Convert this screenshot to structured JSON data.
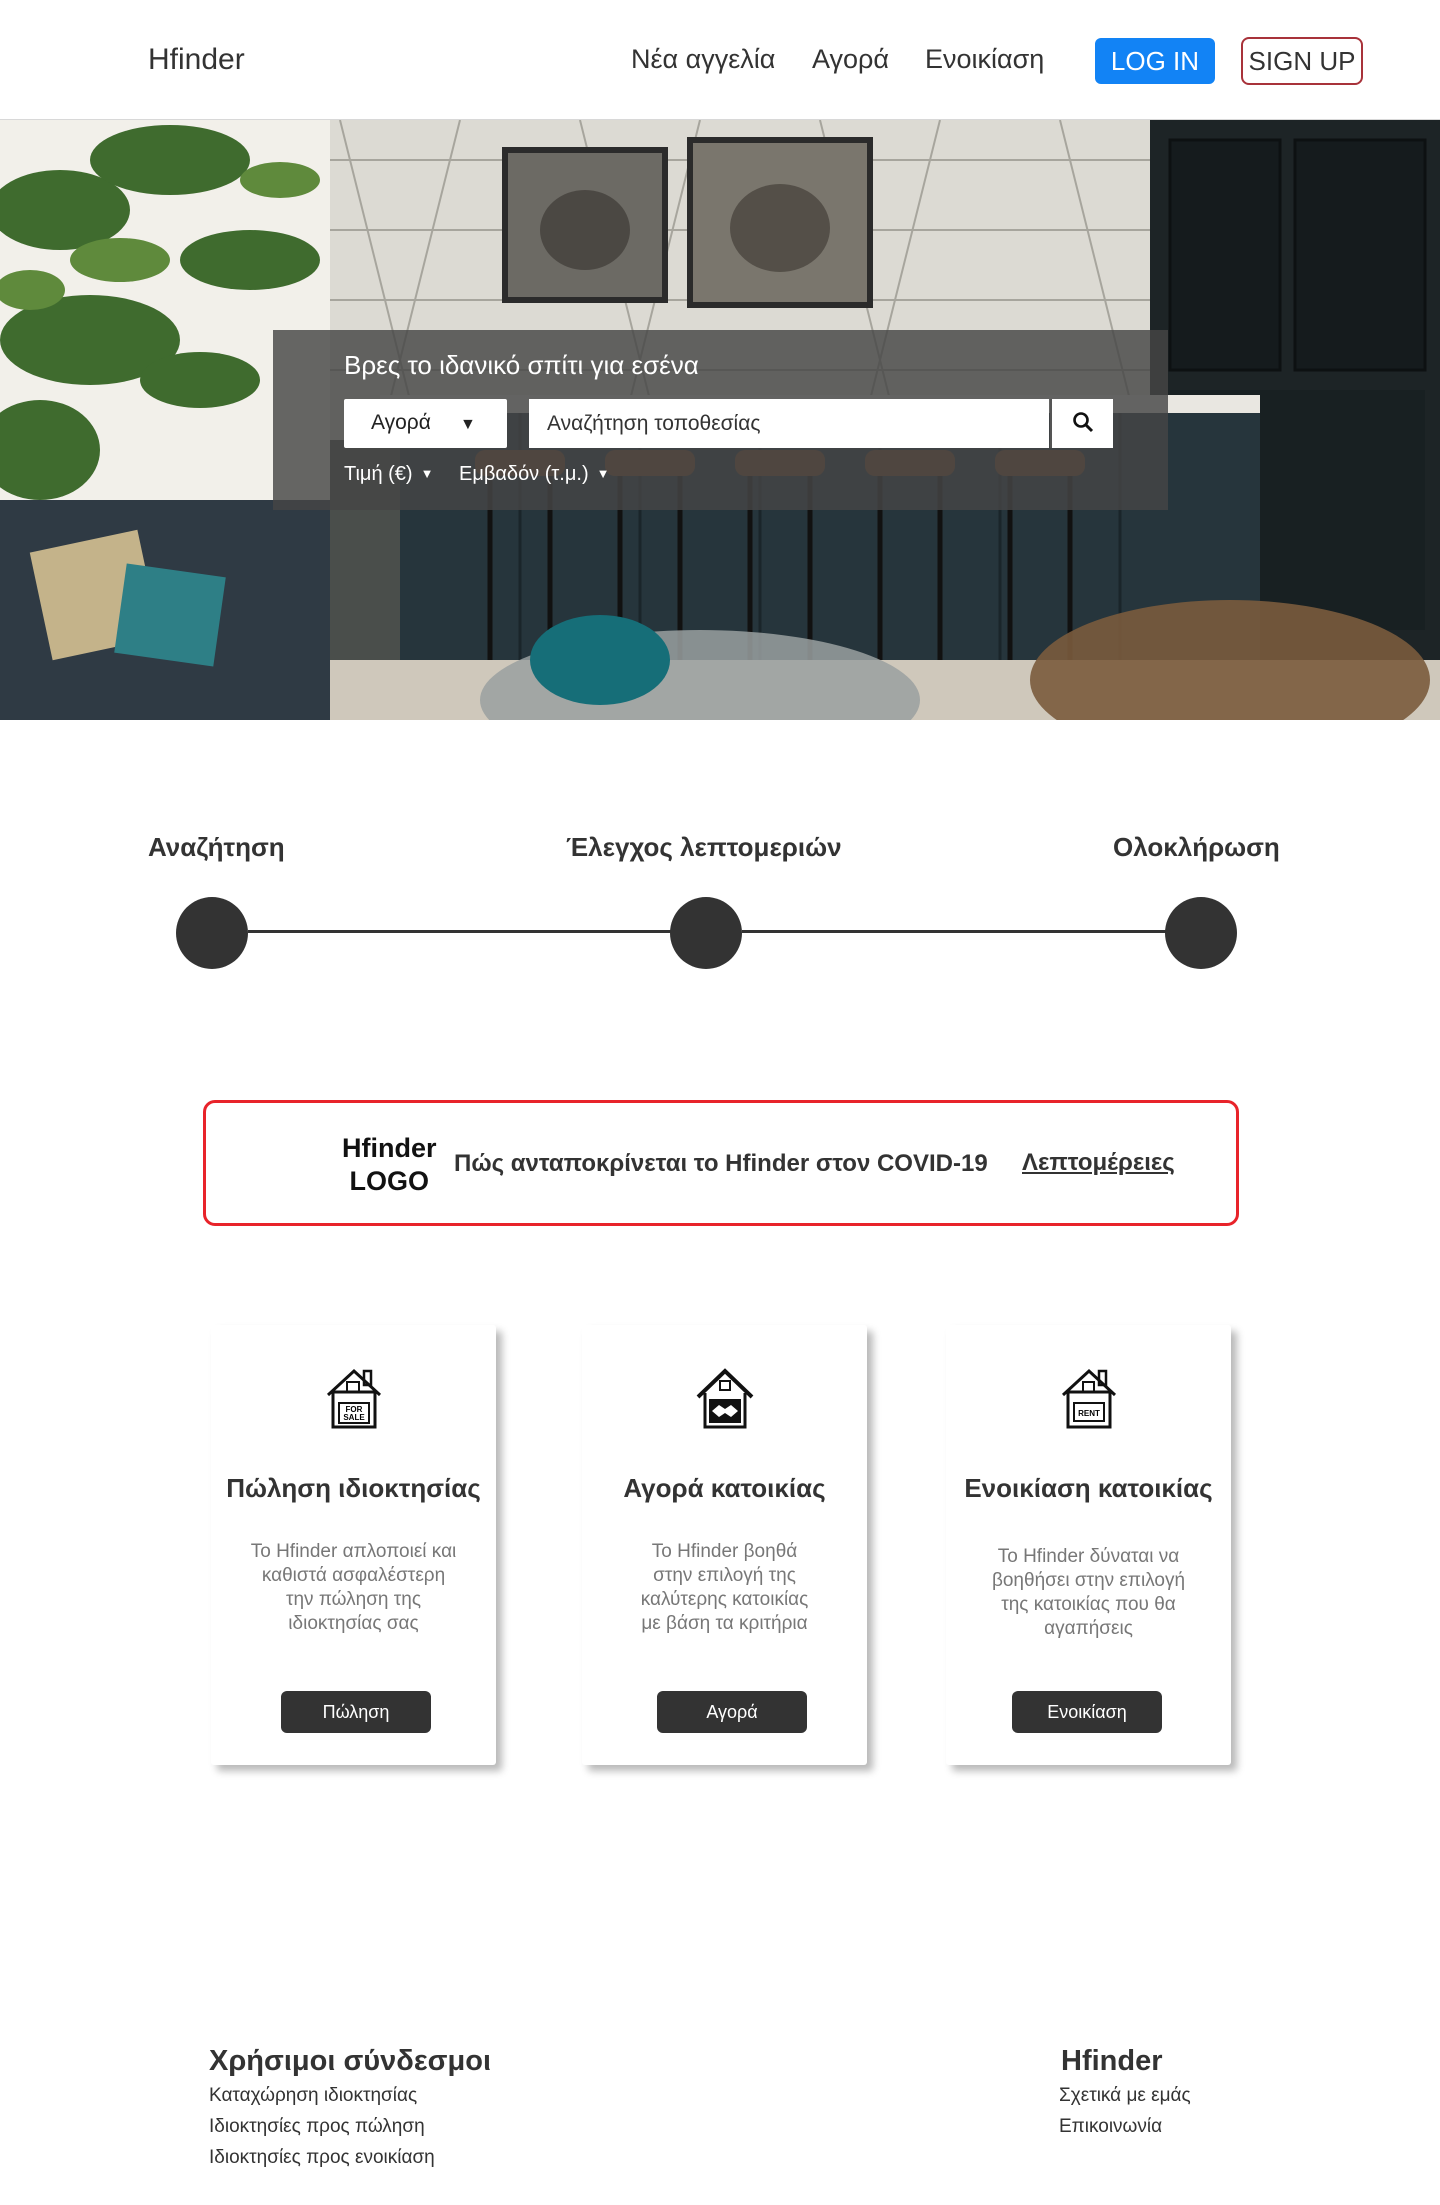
{
  "nav": {
    "brand": "Hfinder",
    "links": [
      "Νέα αγγελία",
      "Αγορά",
      "Ενοικίαση"
    ],
    "login": "LOG IN",
    "signup": "SIGN UP"
  },
  "hero": {
    "title": "Βρες το ιδανικό σπίτι για εσένα",
    "type_selected": "Αγορά",
    "search_placeholder": "Αναζήτηση τοποθεσίας",
    "filters": [
      "Τιμή (€)",
      "Εμβαδόν (τ.μ.)"
    ]
  },
  "steps": [
    "Αναζήτηση",
    "Έλεγχος λεπτομεριών",
    "Ολοκλήρωση"
  ],
  "covid": {
    "logo_line1": "Hfinder",
    "logo_line2": "LOGO",
    "text": "Πώς ανταποκρίνεται το Hfinder στον COVID-19",
    "link": "Λεπτομέρειες"
  },
  "cards": [
    {
      "icon": "house-for-sale-icon",
      "icon_text": [
        "FOR",
        "SALE"
      ],
      "title": "Πώληση ιδιοκτησίας",
      "desc": [
        "Το Hfinder απλοποιεί και",
        "καθιστά ασφαλέστερη",
        "την πώληση της",
        "ιδιοκτησίας σας"
      ],
      "button": "Πώληση"
    },
    {
      "icon": "house-handshake-icon",
      "title": "Αγορά κατοικίας",
      "desc": [
        "Το Hfinder βοηθά",
        "στην επιλογή της",
        "καλύτερης κατοικίας",
        "με βάση τα κριτήρια"
      ],
      "button": "Αγορά"
    },
    {
      "icon": "house-rent-icon",
      "icon_text": [
        "RENT"
      ],
      "title": "Ενοικίαση κατοικίας",
      "desc": [
        "Το Hfinder δύναται να",
        "βοηθήσει στην επιλογή",
        "της κατοικίας που θα",
        "αγαπήσεις"
      ],
      "button": "Ενοικίαση"
    }
  ],
  "footer": {
    "links_heading": "Χρήσιμοι σύνδεσμοι",
    "links": [
      "Καταχώρηση ιδιοκτησίας",
      "Ιδιοκτησίες προς πώληση",
      "Ιδιοκτησίες προς ενοικίαση"
    ],
    "brand_heading": "Hfinder",
    "brand_links": [
      "Σχετικά με εμάς",
      "Επικοινωνία"
    ]
  },
  "colors": {
    "login_bg": "#1283f5",
    "signup_border": "#a8323a",
    "covid_border": "#e8232a",
    "dark": "#333333"
  }
}
